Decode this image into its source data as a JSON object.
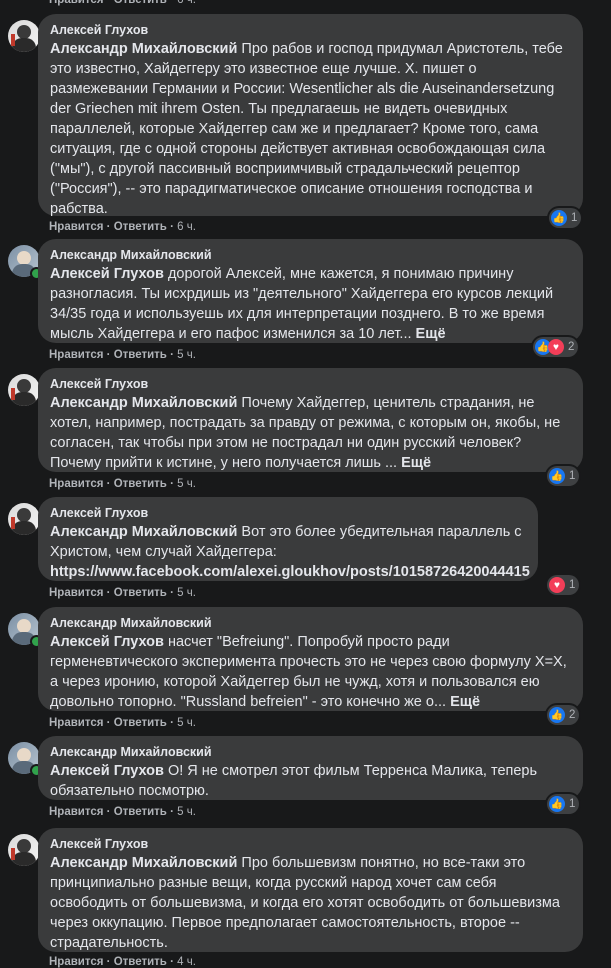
{
  "actions": {
    "like": "Нравится",
    "reply": "Ответить",
    "sep": "·"
  },
  "comments": [
    {
      "author": "Алексей Глухов",
      "mention": "Александр Михайловский",
      "text": " Про рабов и господ придумал Аристотель, тебе это известно, Хайдеггеру это известное еще лучше. Х. пишет о размежевании Германии и России: Wesentlicher als die Auseinandersetzung der Griechen mit ihrem Osten. Ты предлагаешь не видеть очевидных параллелей, которые Хайдеггер сам же и предлагает? Кроме того, сама ситуация, где с одной стороны действует активная освобождающая сила (\"мы\"), с другой пассивный восприимчивый страдальческий рецептор (\"Россия\"), -- это парадигматическое описание отношения господства и рабства.",
      "time": "6 ч.",
      "reactions": "1"
    },
    {
      "author": "Александр Михайловский",
      "mention": "Алексей Глухов",
      "text": " дорогой Алексей, мне кажется, я понимаю причину разногласия. Ты исхрдишь из \"деятельного\" Хайдеггера его курсов лекций 34/35 года и используешь их для интерпретации позднего. В то же время мысль Хайдеггера и его пафос изменился за 10 лет...",
      "more": "Ещё",
      "time": "5 ч.",
      "reactions": "2"
    },
    {
      "author": "Алексей Глухов",
      "mention": "Александр Михайловский",
      "text": " Почему Хайдеггер, ценитель страдания, не хотел, например, пострадать за правду от режима, с которым он, якобы, не согласен, так чтобы при этом не пострадал ни один русский человек? Почему прийти к истине, у него получается лишь ...",
      "more": "Ещё",
      "time": "5 ч.",
      "reactions": "1"
    },
    {
      "author": "Алексей Глухов",
      "mention": "Александр Михайловский",
      "text": " Вот это более убедительная параллель с Христом, чем случай Хайдеггера:",
      "link": "https://www.facebook.com/alexei.gloukhov/posts/10158726420044415",
      "time": "5 ч.",
      "reactions": "1"
    },
    {
      "author": "Александр Михайловский",
      "mention": "Алексей Глухов",
      "text": " насчет \"Befreiung\". Попробуй просто ради герменевтического эксперимента прочесть это не через свою формулу X=X, а через иронию, которой Хайдеггер был не чужд, хотя и пользовался ею довольно топорно. \"Russland befreien\" - это конечно же о...",
      "more": "Ещё",
      "time": "5 ч.",
      "reactions": "2"
    },
    {
      "author": "Александр Михайловский",
      "mention": "Алексей Глухов",
      "text": " О! Я не смотрел этот фильм Терренса Малика, теперь обязательно посмотрю.",
      "time": "5 ч.",
      "reactions": "1"
    },
    {
      "author": "Алексей Глухов",
      "mention": "Александр Михайловский",
      "text": " Про большевизм понятно, но все-таки это принципиально разные вещи, когда русский народ хочет сам себя освободить от большевизма, и когда его хотят освободить от большевизма через оккупацию. Первое предполагает самостоятельность, второе -- страдательность.",
      "time": "4 ч."
    }
  ]
}
